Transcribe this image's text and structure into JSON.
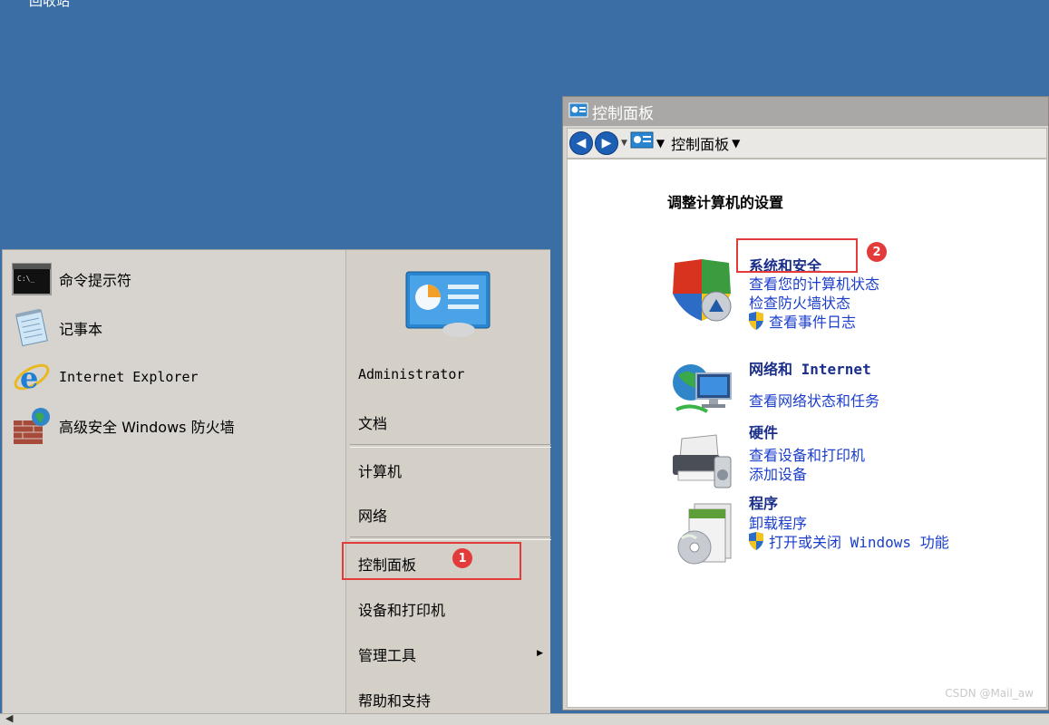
{
  "desktop": {
    "recycle_bin_label": "回收站"
  },
  "start_menu": {
    "programs": [
      {
        "label": "命令提示符",
        "icon": "cmd-icon"
      },
      {
        "label": "记事本",
        "icon": "notepad-icon"
      },
      {
        "label": "Internet Explorer",
        "icon": "ie-icon"
      },
      {
        "label": "高级安全 Windows 防火墙",
        "icon": "firewall-icon"
      }
    ],
    "right_items": {
      "administrator": "Administrator",
      "documents": "文档",
      "computer": "计算机",
      "network": "网络",
      "control_panel": "控制面板",
      "devices_printers": "设备和打印机",
      "admin_tools": "管理工具",
      "help_support": "帮助和支持"
    },
    "submenu_arrow": "▶"
  },
  "annotations": {
    "badge1": "1",
    "badge2": "2",
    "color": "#e33a3a"
  },
  "control_panel": {
    "title": "控制面板",
    "breadcrumb": "控制面板",
    "heading": "调整计算机的设置",
    "categories": [
      {
        "title": "系统和安全",
        "icon": "system-security-icon",
        "links": [
          "查看您的计算机状态",
          "检查防火墙状态",
          "查看事件日志"
        ]
      },
      {
        "title": "网络和 Internet",
        "icon": "network-icon",
        "links": [
          "查看网络状态和任务"
        ]
      },
      {
        "title": "硬件",
        "icon": "hardware-icon",
        "links": [
          "查看设备和打印机",
          "添加设备"
        ]
      },
      {
        "title": "程序",
        "icon": "programs-icon",
        "links": [
          "卸载程序",
          "打开或关闭 Windows 功能"
        ]
      }
    ]
  },
  "watermark": "CSDN @Mail_aw",
  "colors": {
    "desktop": "#3b6ea5",
    "link": "#1b3ecc",
    "category_title": "#1a2e8a"
  }
}
